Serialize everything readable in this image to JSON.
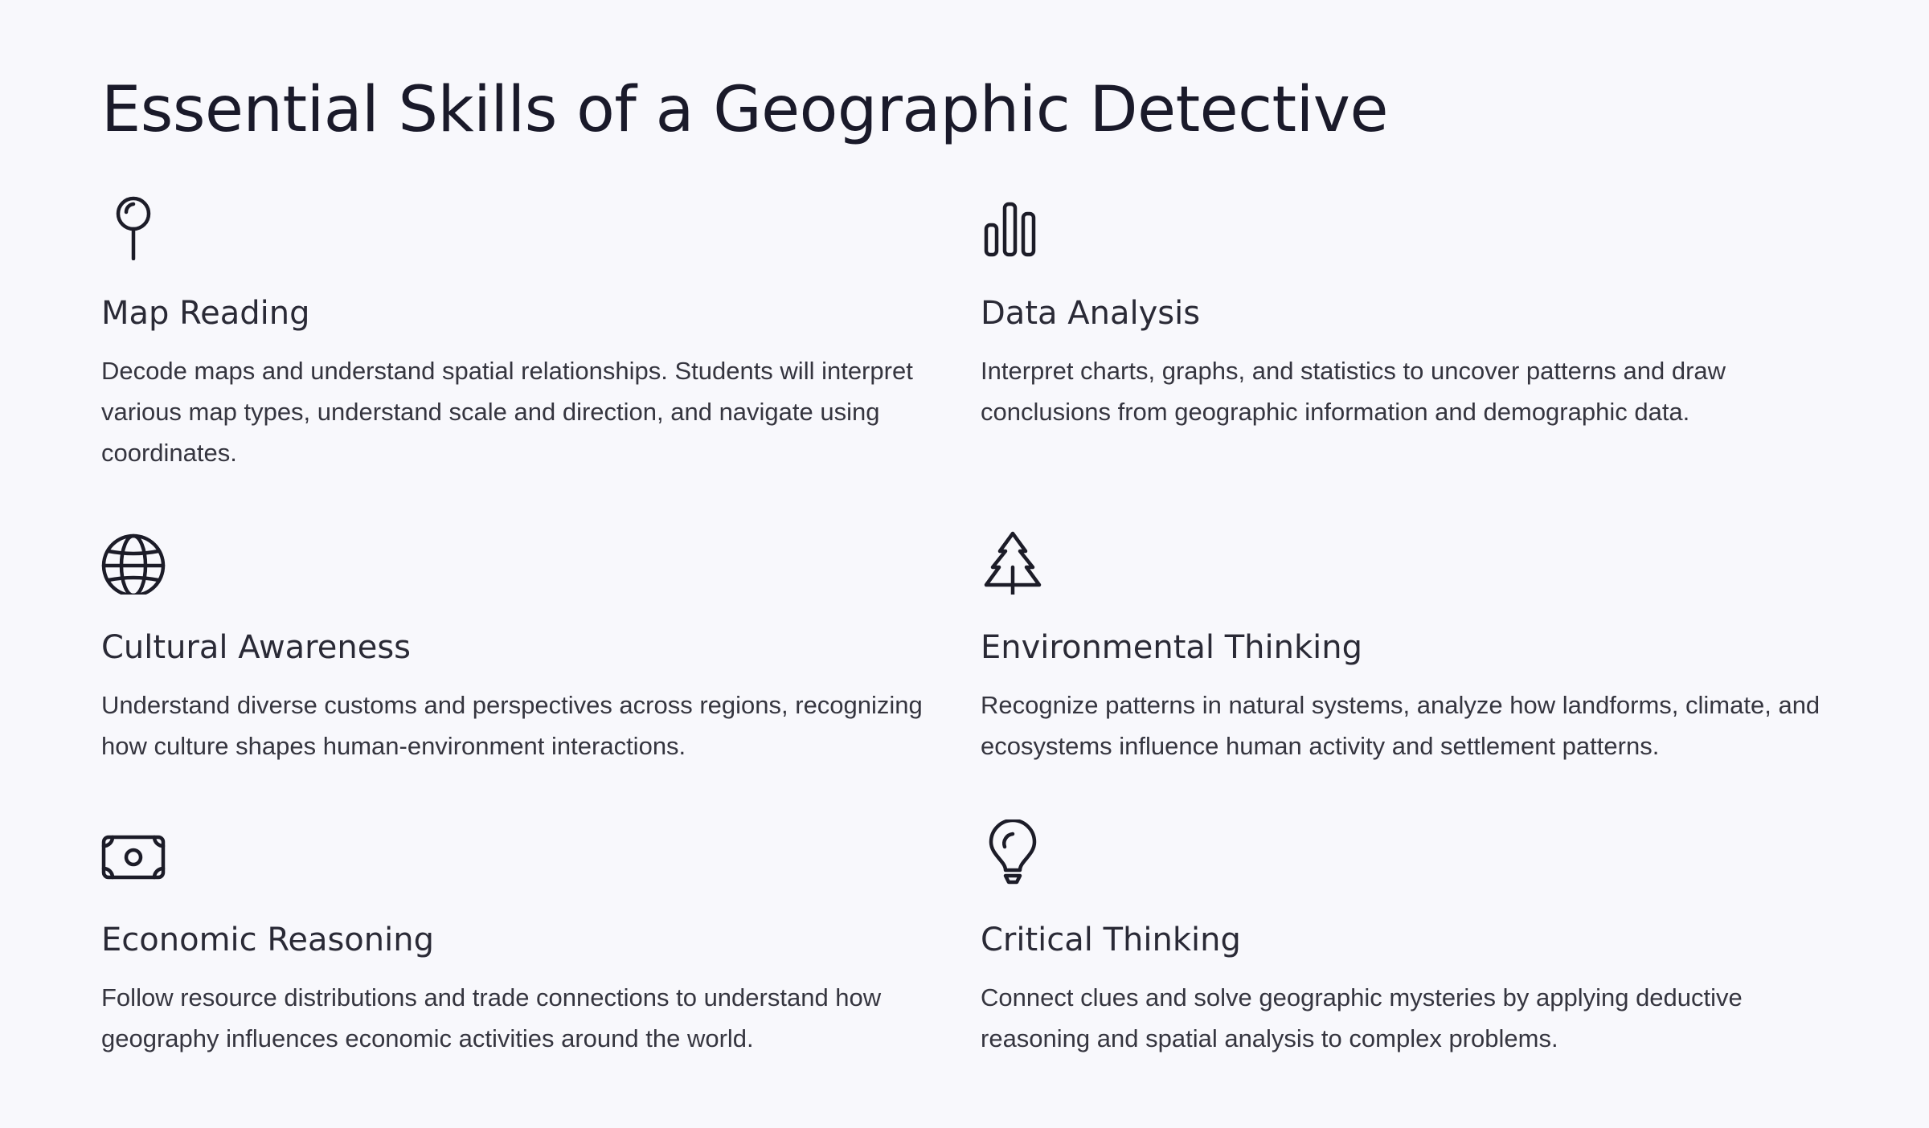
{
  "page": {
    "title": "Essential Skills of a Geographic Detective"
  },
  "skills": [
    {
      "icon": "map-pin-icon",
      "title": "Map Reading",
      "description": "Decode maps and understand spatial relationships. Students will interpret various map types, understand scale and direction, and navigate using coordinates."
    },
    {
      "icon": "bar-chart-icon",
      "title": "Data Analysis",
      "description": "Interpret charts, graphs, and statistics to uncover patterns and draw conclusions from geographic information and demographic data."
    },
    {
      "icon": "globe-icon",
      "title": "Cultural Awareness",
      "description": "Understand diverse customs and perspectives across regions, recognizing how culture shapes human-environment interactions."
    },
    {
      "icon": "tree-icon",
      "title": "Environmental Thinking",
      "description": "Recognize patterns in natural systems, analyze how landforms, climate, and ecosystems influence human activity and settlement patterns."
    },
    {
      "icon": "money-icon",
      "title": "Economic Reasoning",
      "description": "Follow resource distributions and trade connections to understand how geography influences economic activities around the world."
    },
    {
      "icon": "lightbulb-icon",
      "title": "Critical Thinking",
      "description": "Connect clues and solve geographic mysteries by applying deductive reasoning and spatial analysis to complex problems."
    }
  ],
  "colors": {
    "background": "#f8f8fc",
    "heading": "#1a1a2a",
    "body_text": "#35353f",
    "icon_stroke": "#1c1c28"
  }
}
